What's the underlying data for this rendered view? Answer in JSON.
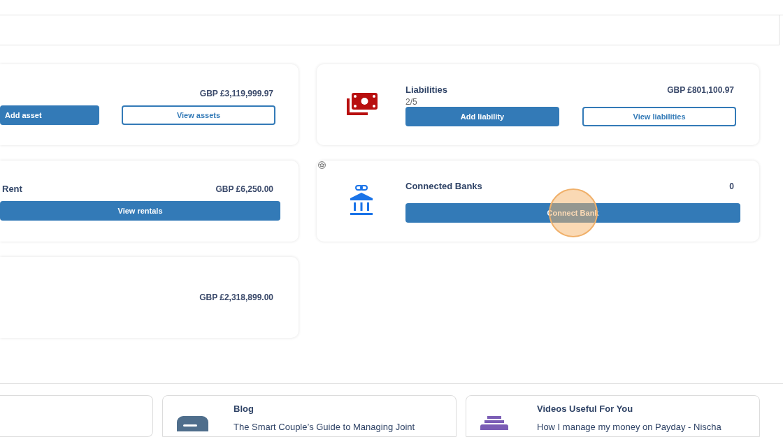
{
  "left_cards": [
    {
      "kind": "pair",
      "amount": "GBP £3,119,999.97",
      "buttons": [
        {
          "label": "Add asset"
        },
        {
          "label": "View assets"
        }
      ]
    },
    {
      "kind": "wide",
      "title": "Rent",
      "amount": "GBP £6,250.00",
      "buttons": [
        {
          "label": "View rentals"
        }
      ]
    },
    {
      "kind": "amount",
      "amount": "GBP £2,318,899.00"
    }
  ],
  "right_cards": [
    {
      "pinned": false,
      "title": "Liabilities",
      "subtitle": "2/5",
      "amount": "GBP £801,100.97",
      "buttons": [
        {
          "label": "Add liability",
          "clicked": false
        },
        {
          "label": "View liabilities",
          "clicked": false
        }
      ]
    },
    {
      "pinned": true,
      "title": "Connected Banks",
      "amount": "0",
      "buttons": [
        {
          "label": "Connect Bank",
          "clicked": true
        }
      ]
    }
  ],
  "resources": [
    {
      "title": "Blog",
      "text": "The Smart Couple’s Guide to Managing Joint"
    },
    {
      "title": "Videos Useful For You",
      "text": "How I manage my money on Payday - Nischa"
    }
  ]
}
